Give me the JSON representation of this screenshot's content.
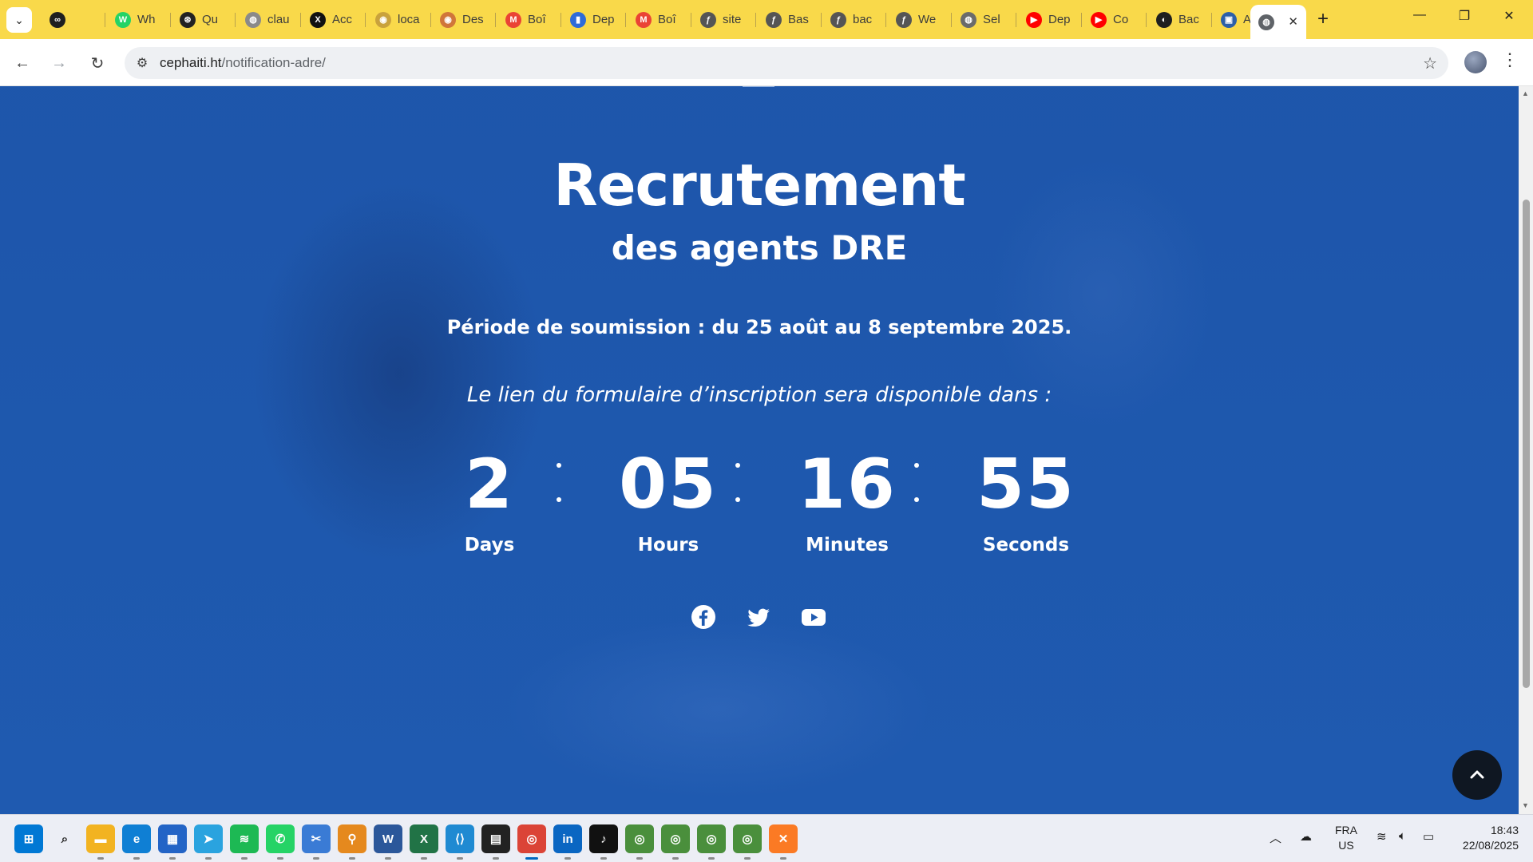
{
  "browser": {
    "tabs": [
      {
        "label": "",
        "icon": "infinity-icon",
        "color": "#1f1f1f",
        "glyph": "∞"
      },
      {
        "label": "Wh",
        "icon": "whatsapp-icon",
        "color": "#25d366",
        "glyph": "W"
      },
      {
        "label": "Qu",
        "icon": "openai-icon",
        "color": "#222222",
        "glyph": "⊛"
      },
      {
        "label": "clau",
        "icon": "globe-icon",
        "color": "#8a8a8a",
        "glyph": "◍"
      },
      {
        "label": "Acc",
        "icon": "x-twitter-icon",
        "color": "#111111",
        "glyph": "X"
      },
      {
        "label": "loca",
        "icon": "avatar-icon",
        "color": "#c9a23c",
        "glyph": "◉"
      },
      {
        "label": "Des",
        "icon": "avatar-icon",
        "color": "#d0763a",
        "glyph": "◉"
      },
      {
        "label": "Boî",
        "icon": "gmail-icon",
        "color": "#ea4335",
        "glyph": "M"
      },
      {
        "label": "Dep",
        "icon": "doc-icon",
        "color": "#2f6bd8",
        "glyph": "▮"
      },
      {
        "label": "Boî",
        "icon": "gmail-icon",
        "color": "#ea4335",
        "glyph": "M"
      },
      {
        "label": "site",
        "icon": "feather-icon",
        "color": "#555555",
        "glyph": "ƒ"
      },
      {
        "label": "Bas",
        "icon": "feather-icon",
        "color": "#555555",
        "glyph": "ƒ"
      },
      {
        "label": "bac",
        "icon": "feather-icon",
        "color": "#555555",
        "glyph": "ƒ"
      },
      {
        "label": "We",
        "icon": "feather-icon",
        "color": "#555555",
        "glyph": "ƒ"
      },
      {
        "label": "Sel",
        "icon": "globe-icon",
        "color": "#6b6b6b",
        "glyph": "◍"
      },
      {
        "label": "Dep",
        "icon": "youtube-icon",
        "color": "#ff0000",
        "glyph": "▶"
      },
      {
        "label": "Co",
        "icon": "youtube-icon",
        "color": "#ff0000",
        "glyph": "▶"
      },
      {
        "label": "Bac",
        "icon": "github-icon",
        "color": "#1f1f1f",
        "glyph": "◐"
      },
      {
        "label": "Acc",
        "icon": "monitor-icon",
        "color": "#2c5fa8",
        "glyph": "▣"
      }
    ],
    "active_tab": {
      "label": "",
      "icon": "globe-icon"
    },
    "url_host": "cephaiti.ht",
    "url_path": "/notification-adre/"
  },
  "page": {
    "title": "Recrutement",
    "subtitle": "des agents DRE",
    "period": "Période de soumission : du 25 août au 8 septembre 2025.",
    "lead": "Le lien du formulaire d’inscription sera disponible dans :",
    "countdown": [
      {
        "value": "2",
        "label": "Days"
      },
      {
        "value": "05",
        "label": "Hours"
      },
      {
        "value": "16",
        "label": "Minutes"
      },
      {
        "value": "55",
        "label": "Seconds"
      }
    ],
    "social": [
      "facebook-icon",
      "twitter-icon",
      "youtube-icon"
    ]
  },
  "colors": {
    "background": "#1f5ab0",
    "tabstrip": "#f9d94a",
    "text": "#ffffff",
    "scroll_top_button": "#0f1722"
  },
  "taskbar": {
    "apps": [
      "start-icon",
      "search-icon",
      "file-explorer-icon",
      "edge-icon",
      "store-icon",
      "telegram-icon",
      "spotify-icon",
      "whatsapp-icon",
      "snipping-tool-icon",
      "magnifier-icon",
      "word-icon",
      "excel-icon",
      "vscode-icon",
      "terminal-icon",
      "chrome-icon",
      "linkedin-icon",
      "tiktok-icon",
      "chrome-profile-icon",
      "chrome-profile-icon",
      "chrome-profile-icon",
      "chrome-profile-icon",
      "xampp-icon"
    ],
    "lang_primary": "FRA",
    "lang_secondary": "US",
    "time": "18:43",
    "date": "22/08/2025"
  }
}
